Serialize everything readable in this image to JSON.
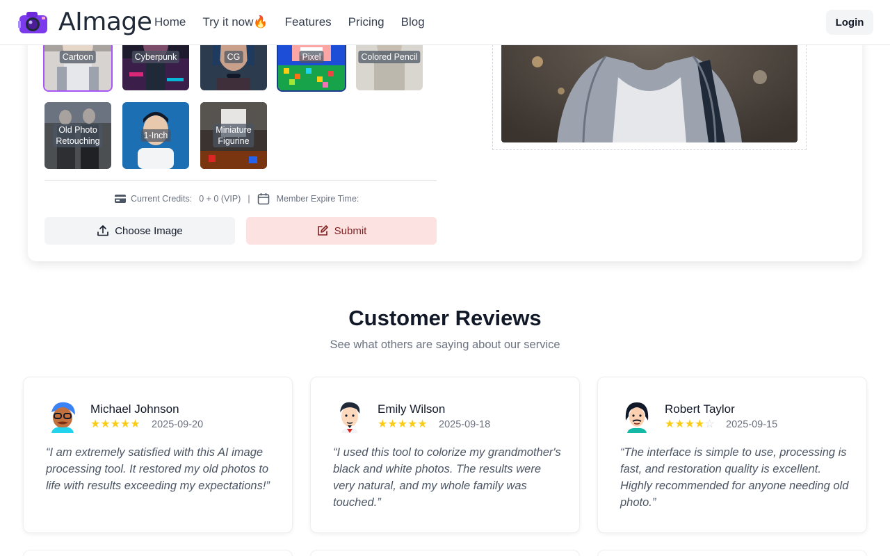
{
  "header": {
    "brand": "AImage",
    "nav": [
      "Home",
      "Try it now🔥",
      "Features",
      "Pricing",
      "Blog"
    ],
    "login_label": "Login"
  },
  "styles": [
    {
      "label": "Cartoon",
      "selected": true
    },
    {
      "label": "Cyberpunk"
    },
    {
      "label": "CG"
    },
    {
      "label": "Pixel"
    },
    {
      "label": "Colored Pencil"
    },
    {
      "label": "Old Photo\nRetouching"
    },
    {
      "label": "1-Inch"
    },
    {
      "label": "Miniature\nFigurine"
    }
  ],
  "credits": {
    "label": "Current Credits:",
    "value": "0 + 0 (VIP)",
    "separator": "|",
    "expire_label": "Member Expire Time:"
  },
  "actions": {
    "choose_label": "Choose Image",
    "submit_label": "Submit"
  },
  "reviews": {
    "title": "Customer Reviews",
    "subtitle": "See what others are saying about our service",
    "items": [
      {
        "name": "Michael Johnson",
        "rating": 5,
        "date": "2025-09-20",
        "quote": "“I am extremely satisfied with this AI image processing tool. It restored my old photos to life with results exceeding my expectations!”"
      },
      {
        "name": "Emily Wilson",
        "rating": 5,
        "date": "2025-09-18",
        "quote": "“I used this tool to colorize my grandmother's black and white photos. The results were very natural, and my whole family was touched.”"
      },
      {
        "name": "Robert Taylor",
        "rating": 4,
        "date": "2025-09-15",
        "quote": "“The interface is simple to use, processing is fast, and restoration quality is excellent. Highly recommended for anyone needing old photo.”"
      }
    ]
  },
  "colors": {
    "accent_purple": "#a855f7",
    "submit_bg": "#fde2e2",
    "star": "#facc15"
  }
}
